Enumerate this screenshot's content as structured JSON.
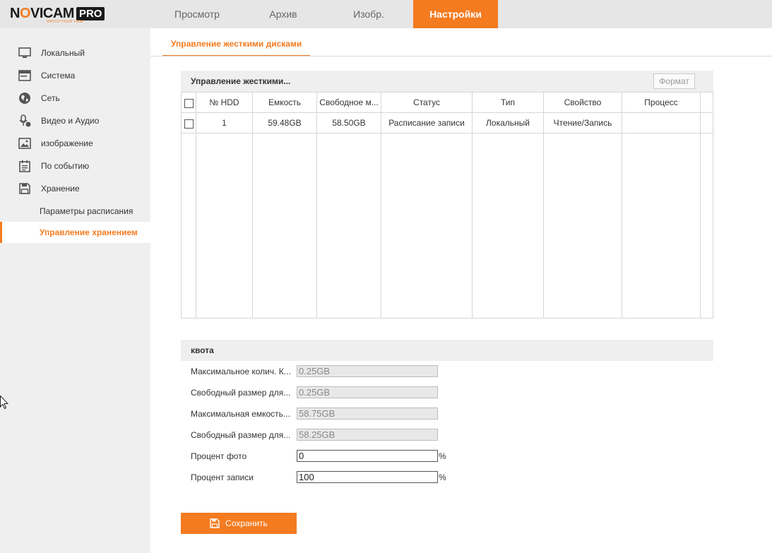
{
  "header": {
    "logo_text": "NOVICAM",
    "logo_badge": "PRO",
    "logo_tagline": "WATCH YOUR VIEW",
    "tabs": [
      {
        "label": "Просмотр",
        "active": false
      },
      {
        "label": "Архив",
        "active": false
      },
      {
        "label": "Изобр.",
        "active": false
      },
      {
        "label": "Настройки",
        "active": true
      }
    ]
  },
  "sidebar": {
    "items": [
      {
        "label": "Локальный",
        "icon": "monitor-icon"
      },
      {
        "label": "Система",
        "icon": "system-window-icon"
      },
      {
        "label": "Сеть",
        "icon": "globe-icon"
      },
      {
        "label": "Видео и Аудио",
        "icon": "microphone-icon"
      },
      {
        "label": "изображение",
        "icon": "image-icon"
      },
      {
        "label": "По событию",
        "icon": "calendar-icon"
      },
      {
        "label": "Хранение",
        "icon": "floppy-icon"
      }
    ],
    "subitems": [
      {
        "label": "Параметры расписания",
        "active": false
      },
      {
        "label": "Управление хранением",
        "active": true
      }
    ]
  },
  "main": {
    "subtab": "Управление жесткими дисками",
    "hdd_section": {
      "title": "Управление жесткими...",
      "format_button": "Формат",
      "columns": [
        "№ HDD",
        "Емкость",
        "Свободное м...",
        "Статус",
        "Тип",
        "Свойство",
        "Процесс"
      ],
      "rows": [
        {
          "hdd": "1",
          "capacity": "59.48GB",
          "free": "58.50GB",
          "status": "Расписание записи",
          "type": "Локальный",
          "property": "Чтение/Запись",
          "process": ""
        }
      ]
    },
    "quota_section": {
      "title": "квота",
      "fields": [
        {
          "label": "Максимальное колич. К...",
          "value": "0.25GB",
          "editable": false
        },
        {
          "label": "Свободный размер для...",
          "value": "0.25GB",
          "editable": false
        },
        {
          "label": "Максимальная емкость...",
          "value": "58.75GB",
          "editable": false
        },
        {
          "label": "Свободный размер для...",
          "value": "58.25GB",
          "editable": false
        },
        {
          "label": "Процент фото",
          "value": "0",
          "editable": true,
          "suffix": "%"
        },
        {
          "label": "Процент записи",
          "value": "100",
          "editable": true,
          "suffix": "%"
        }
      ]
    },
    "save_button": "Сохранить"
  },
  "colors": {
    "accent": "#f47b20",
    "topbar_bg": "#e6e6e6",
    "sidebar_bg": "#efefef"
  }
}
